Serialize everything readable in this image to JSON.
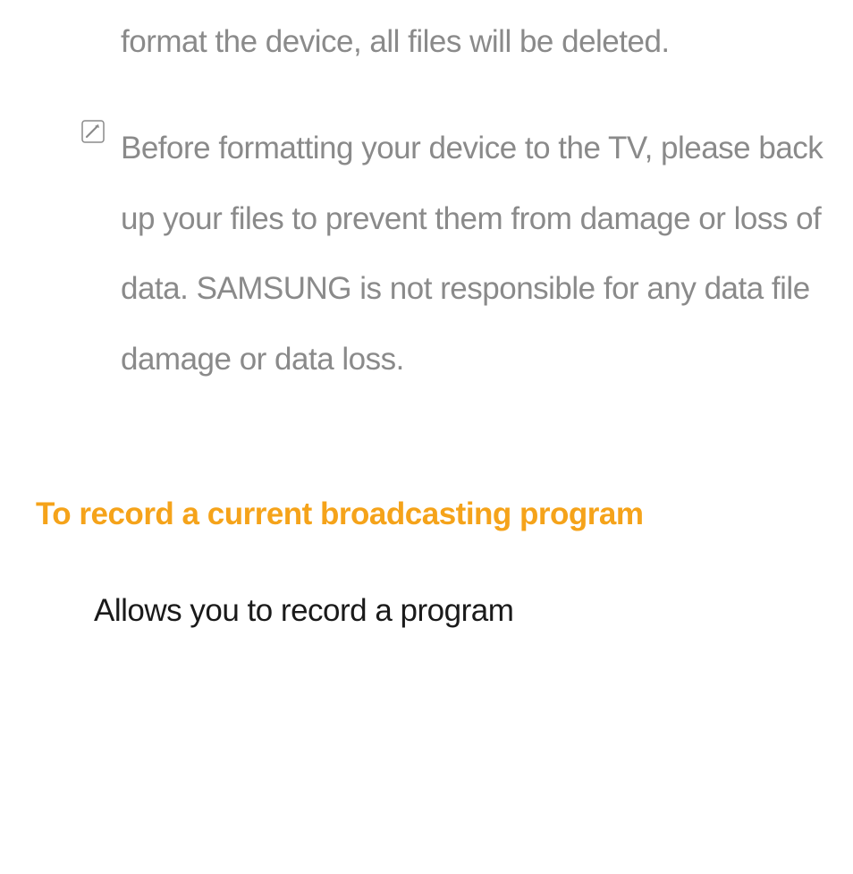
{
  "para1": "format the device, all files will be deleted.",
  "note": {
    "icon_name": "note-icon",
    "text": "Before formatting your device to the TV, please back up your files to prevent them from damage or loss of data. SAMSUNG is not responsible for any data file damage or data loss."
  },
  "heading": "To record a current broadcasting program",
  "para3": "Allows you to record a program"
}
